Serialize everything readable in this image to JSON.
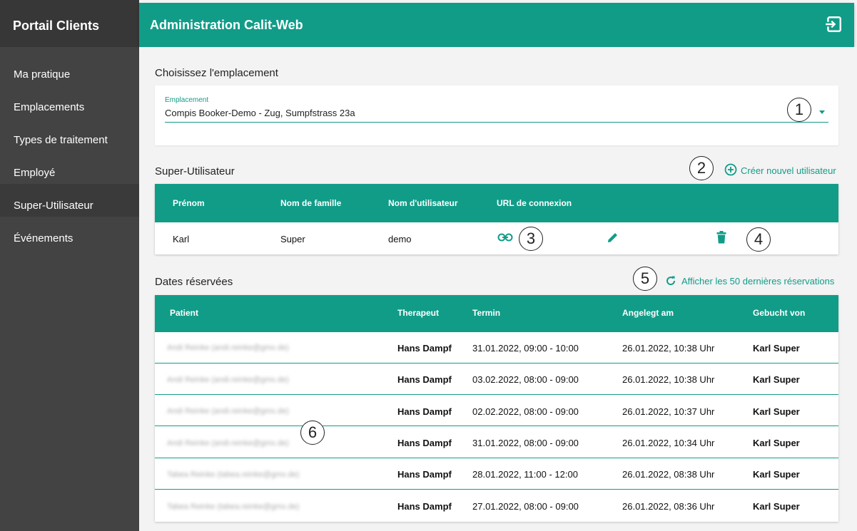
{
  "sidebar": {
    "title": "Portail Clients",
    "items": [
      {
        "label": "Ma pratique"
      },
      {
        "label": "Emplacements"
      },
      {
        "label": "Types de traitement"
      },
      {
        "label": "Employé"
      },
      {
        "label": "Super-Utilisateur",
        "active": true
      },
      {
        "label": "Événements"
      }
    ]
  },
  "header": {
    "title": "Administration Calit-Web",
    "logout_icon": "logout-icon"
  },
  "location": {
    "section_label": "Choisissez l'emplacement",
    "field_label": "Emplacement",
    "value": "Compis Booker-Demo - Zug, Sumpfstrass 23a"
  },
  "super_users": {
    "section_label": "Super-Utilisateur",
    "create_label": "Créer nouvel utilisateur",
    "columns": [
      "Prénom",
      "Nom de famille",
      "Nom d'utilisateur",
      "URL de connexion"
    ],
    "rows": [
      {
        "first": "Karl",
        "last": "Super",
        "username": "demo"
      }
    ]
  },
  "bookings": {
    "section_label": "Dates réservées",
    "refresh_label": "Afficher les 50 dernières réservations",
    "columns": [
      "Patient",
      "Therapeut",
      "Termin",
      "Angelegt am",
      "Gebucht von"
    ],
    "rows": [
      {
        "patient": "Andi Reinke (andi.reinke@gmx.de)",
        "therapist": "Hans Dampf",
        "termin": "31.01.2022, 09:00 - 10:00",
        "created": "26.01.2022, 10:38 Uhr",
        "booked_by": "Karl Super"
      },
      {
        "patient": "Andi Reinke (andi.reinke@gmx.de)",
        "therapist": "Hans Dampf",
        "termin": "03.02.2022, 08:00 - 09:00",
        "created": "26.01.2022, 10:38 Uhr",
        "booked_by": "Karl Super"
      },
      {
        "patient": "Andi Reinke (andi.reinke@gmx.de)",
        "therapist": "Hans Dampf",
        "termin": "02.02.2022, 08:00 - 09:00",
        "created": "26.01.2022, 10:37 Uhr",
        "booked_by": "Karl Super"
      },
      {
        "patient": "Andi Reinke (andi.reinke@gmx.de)",
        "therapist": "Hans Dampf",
        "termin": "31.01.2022, 08:00 - 09:00",
        "created": "26.01.2022, 10:34 Uhr",
        "booked_by": "Karl Super"
      },
      {
        "patient": "Tabea Reinke (tabea.reinke@gmx.de)",
        "therapist": "Hans Dampf",
        "termin": "28.01.2022, 11:00 - 12:00",
        "created": "26.01.2022, 08:38 Uhr",
        "booked_by": "Karl Super"
      },
      {
        "patient": "Tabea Reinke (tabea.reinke@gmx.de)",
        "therapist": "Hans Dampf",
        "termin": "27.01.2022, 08:00 - 09:00",
        "created": "26.01.2022, 08:36 Uhr",
        "booked_by": "Karl Super"
      }
    ]
  },
  "callouts": [
    "1",
    "2",
    "3",
    "4",
    "5",
    "6"
  ],
  "colors": {
    "accent": "#119c88",
    "sidebar": "#434343"
  }
}
